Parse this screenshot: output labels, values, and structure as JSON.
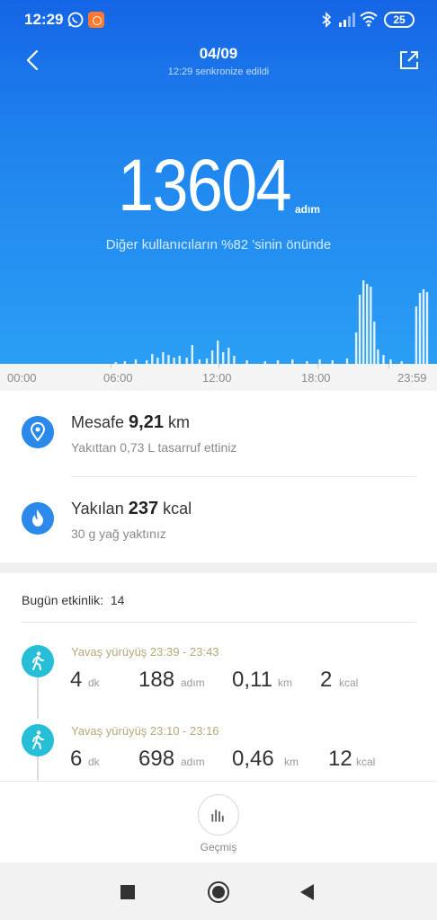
{
  "status_bar": {
    "time": "12:29",
    "battery": "25",
    "icons": [
      "whatsapp-icon",
      "app-notification-icon",
      "bluetooth-icon",
      "signal-icon",
      "wifi-icon",
      "battery-icon"
    ]
  },
  "header": {
    "date": "04/09",
    "sync_text": "12:29 senkronize edildi",
    "back_icon": "chevron-left-icon",
    "share_icon": "share-icon"
  },
  "steps": {
    "value": "13604",
    "unit": "adım",
    "ranking": "Diğer kullanıcıların %82 'sinin önünde"
  },
  "chart_data": {
    "type": "bar",
    "title": "",
    "x_tick_labels": [
      "00:00",
      "06:00",
      "12:00",
      "18:00",
      "23:59"
    ],
    "x_range_hours": [
      0,
      24
    ],
    "y_scale_relative": [
      0,
      1
    ],
    "series": [
      {
        "values_relative": [
          {
            "hour": 6.3,
            "v": 0.02
          },
          {
            "hour": 6.8,
            "v": 0.03
          },
          {
            "hour": 7.4,
            "v": 0.05
          },
          {
            "hour": 8.0,
            "v": 0.04
          },
          {
            "hour": 8.3,
            "v": 0.11
          },
          {
            "hour": 8.6,
            "v": 0.07
          },
          {
            "hour": 8.9,
            "v": 0.13
          },
          {
            "hour": 9.2,
            "v": 0.1
          },
          {
            "hour": 9.5,
            "v": 0.07
          },
          {
            "hour": 9.8,
            "v": 0.09
          },
          {
            "hour": 10.2,
            "v": 0.07
          },
          {
            "hour": 10.5,
            "v": 0.21
          },
          {
            "hour": 10.9,
            "v": 0.05
          },
          {
            "hour": 11.3,
            "v": 0.06
          },
          {
            "hour": 11.6,
            "v": 0.15
          },
          {
            "hour": 11.9,
            "v": 0.26
          },
          {
            "hour": 12.2,
            "v": 0.13
          },
          {
            "hour": 12.5,
            "v": 0.18
          },
          {
            "hour": 12.8,
            "v": 0.09
          },
          {
            "hour": 13.5,
            "v": 0.04
          },
          {
            "hour": 14.5,
            "v": 0.03
          },
          {
            "hour": 15.2,
            "v": 0.04
          },
          {
            "hour": 16.0,
            "v": 0.05
          },
          {
            "hour": 16.8,
            "v": 0.03
          },
          {
            "hour": 17.5,
            "v": 0.05
          },
          {
            "hour": 18.2,
            "v": 0.04
          },
          {
            "hour": 19.0,
            "v": 0.06
          },
          {
            "hour": 19.5,
            "v": 0.35
          },
          {
            "hour": 19.7,
            "v": 0.77
          },
          {
            "hour": 19.9,
            "v": 0.93
          },
          {
            "hour": 20.1,
            "v": 0.89
          },
          {
            "hour": 20.3,
            "v": 0.86
          },
          {
            "hour": 20.5,
            "v": 0.47
          },
          {
            "hour": 20.7,
            "v": 0.16
          },
          {
            "hour": 21.0,
            "v": 0.1
          },
          {
            "hour": 21.4,
            "v": 0.05
          },
          {
            "hour": 22.0,
            "v": 0.03
          },
          {
            "hour": 22.8,
            "v": 0.64
          },
          {
            "hour": 23.0,
            "v": 0.79
          },
          {
            "hour": 23.2,
            "v": 0.83
          },
          {
            "hour": 23.4,
            "v": 0.8
          }
        ]
      }
    ]
  },
  "metrics": {
    "distance": {
      "label": "Mesafe",
      "value": "9,21",
      "unit": "km",
      "sub": "Yakıttan 0,73 L tasarruf ettiniz",
      "icon": "location-pin-icon"
    },
    "calories": {
      "label": "Yakılan",
      "value": "237",
      "unit": "kcal",
      "sub": "30 g yağ yaktınız",
      "icon": "flame-icon"
    }
  },
  "activity_summary": {
    "label": "Bugün etkinlik:",
    "count": "14"
  },
  "activities": [
    {
      "label": "Yavaş yürüyüş 23:39 - 23:43",
      "duration": "4",
      "duration_unit": "dk",
      "steps": "188",
      "steps_unit": "adım",
      "distance": "0,11",
      "distance_unit": "km",
      "kcal": "2",
      "kcal_unit": "kcal",
      "icon": "walking-person-icon"
    },
    {
      "label": "Yavaş yürüyüş 23:10 - 23:16",
      "duration": "6",
      "duration_unit": "dk",
      "steps": "698",
      "steps_unit": "adım",
      "distance": "0,46",
      "distance_unit": "km",
      "kcal": "12",
      "kcal_unit": "kcal",
      "icon": "walking-person-icon"
    }
  ],
  "history": {
    "label": "Geçmiş",
    "icon": "bar-chart-icon"
  },
  "nav": {
    "recents_icon": "square-icon",
    "home_icon": "circle-icon",
    "back_icon": "triangle-back-icon"
  },
  "colors": {
    "hero_top": "#1565e6",
    "hero_bottom": "#2a9ef5",
    "metric_icon": "#2b89ec",
    "activity_icon": "#27bfd8"
  }
}
